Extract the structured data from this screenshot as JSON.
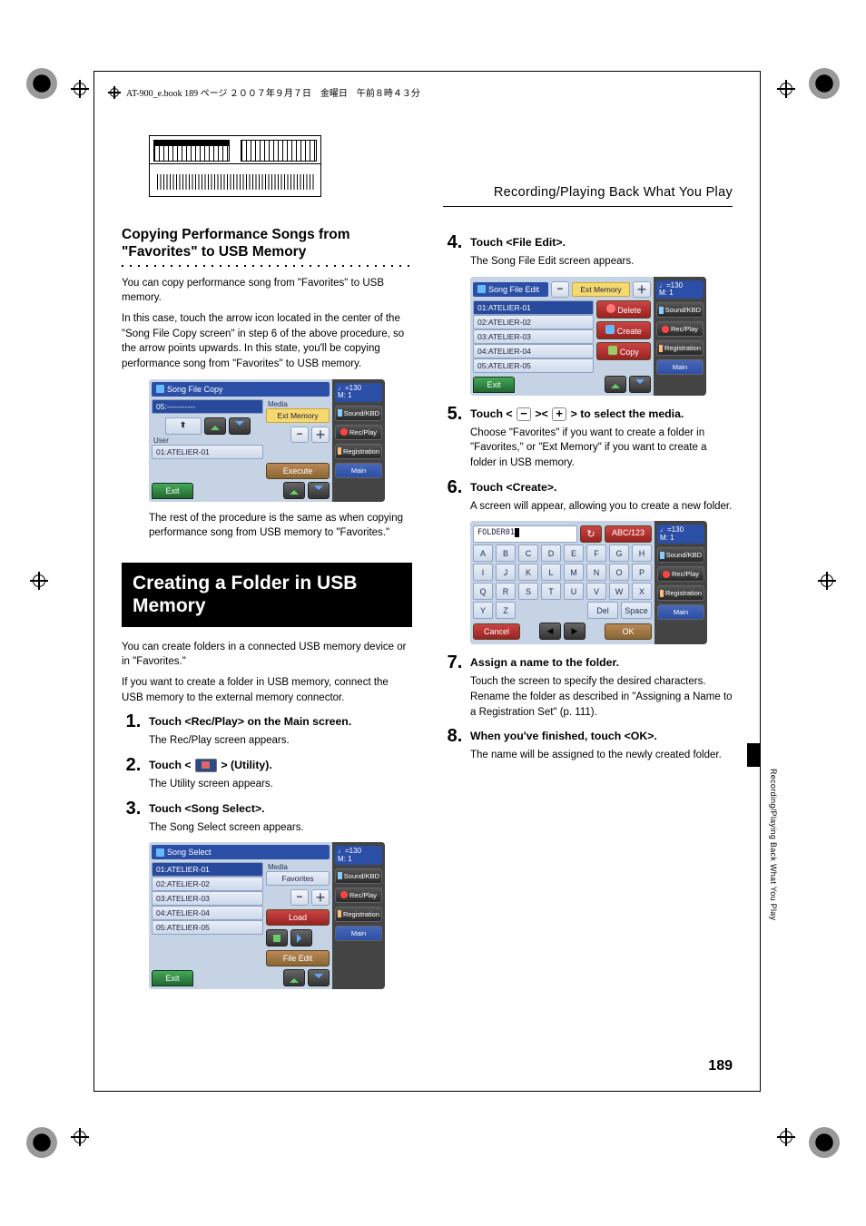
{
  "book_header": "AT-900_e.book  189 ページ  ２００７年９月７日　金曜日　午前８時４３分",
  "section_header_right": "Recording/Playing Back What You Play",
  "left": {
    "subhead": "Copying Performance Songs from \"Favorites\" to USB Memory",
    "para1": "You can copy performance song from \"Favorites\" to USB memory.",
    "para2": "In this case, touch the arrow icon located in the center of the \"Song File Copy screen\" in step 6 of the above procedure, so the arrow points upwards. In this state, you'll be copying performance song from \"Favorites\" to USB memory.",
    "para3": "The rest of the procedure is the same as when copying performance song from USB memory to \"Favorites.\"",
    "sect_bar": "Creating a Folder in USB Memory",
    "para4": "You can create folders in a connected USB memory device or in \"Favorites.\"",
    "para5": "If you want to create a folder in USB memory, connect the USB memory to the external memory connector.",
    "step1": "Touch <Rec/Play> on the Main screen.",
    "step1_sub": "The Rec/Play screen appears.",
    "step2_pre": "Touch < ",
    "step2_post": " > (Utility).",
    "step2_sub": "The Utility screen appears.",
    "step3": "Touch <Song Select>.",
    "step3_sub": "The Song Select screen appears."
  },
  "right": {
    "step4": "Touch <File Edit>.",
    "step4_sub": "The Song File Edit screen appears.",
    "step5_pre": "Touch < ",
    "step5_mid": " >< ",
    "step5_post": " > to select the media.",
    "step5_sub": "Choose \"Favorites\" if you want to create a folder in \"Favorites,\" or \"Ext Memory\" if you want to create a folder in USB memory.",
    "step6": "Touch <Create>.",
    "step6_sub": "A screen will appear, allowing you to create a new folder.",
    "step7": "Assign a name to the folder.",
    "step7_sub": "Touch the screen to specify the desired characters. Rename the folder as described in \"Assigning a Name to a Registration Set\" (p. 111).",
    "step8": "When you've finished, touch <OK>.",
    "step8_sub": "The name will be assigned to the newly created folder."
  },
  "lcd": {
    "tempo_top": "♩=130",
    "tempo_bot": "M:    1",
    "side_sound": "Sound/KBD",
    "side_rec": "Rec/Play",
    "side_reg": "Registration",
    "side_main": "Main",
    "copy": {
      "title": "Song File Copy",
      "media_label": "Media",
      "media_value": "Ext Memory",
      "src": "05:-----------",
      "user_label": "User",
      "user_value": "01:ATELIER-01",
      "exit": "Exit",
      "execute": "Execute"
    },
    "select": {
      "title": "Song Select",
      "media_label": "Media",
      "media_value": "Favorites",
      "items": [
        "01:ATELIER-01",
        "02:ATELIER-02",
        "03:ATELIER-03",
        "04:ATELIER-04",
        "05:ATELIER-05"
      ],
      "load": "Load",
      "file_edit": "File Edit",
      "exit": "Exit"
    },
    "edit": {
      "title": "Song File Edit",
      "media_value": "Ext Memory",
      "items": [
        "01:ATELIER-01",
        "02:ATELIER-02",
        "03:ATELIER-03",
        "04:ATELIER-04",
        "05:ATELIER-05"
      ],
      "delete": "Delete",
      "create": "Create",
      "copy": "Copy",
      "exit": "Exit"
    },
    "name": {
      "field": "FOLDER01",
      "mode": "ABC/123",
      "keys_r1": [
        "A",
        "B",
        "C",
        "D",
        "E",
        "F",
        "G",
        "H"
      ],
      "keys_r2": [
        "I",
        "J",
        "K",
        "L",
        "M",
        "N",
        "O",
        "P"
      ],
      "keys_r3": [
        "Q",
        "R",
        "S",
        "T",
        "U",
        "V",
        "W",
        "X"
      ],
      "keys_r4": [
        "Y",
        "Z"
      ],
      "del": "Del",
      "space": "Space",
      "cancel": "Cancel",
      "ok": "OK"
    }
  },
  "side_text": "Recording/Playing Back What You Play",
  "page_number": "189"
}
